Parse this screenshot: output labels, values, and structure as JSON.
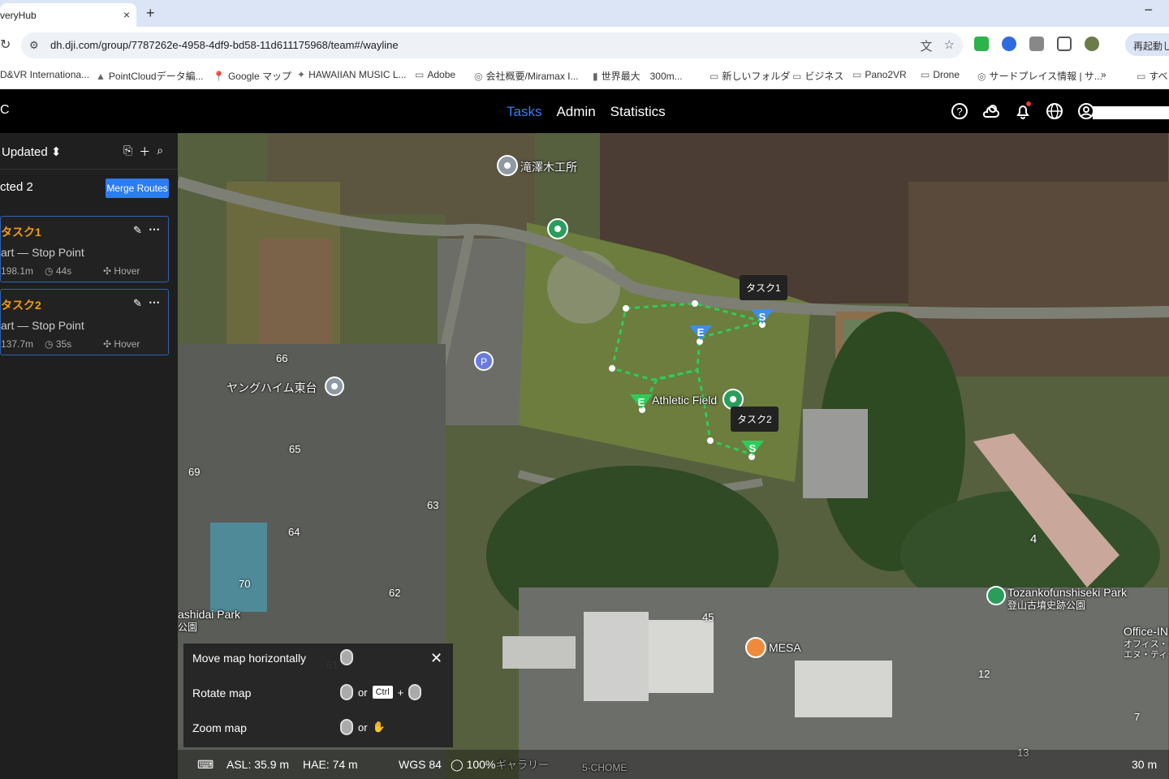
{
  "browser": {
    "tab_title": "veryHub",
    "tab_close": "×",
    "new_tab": "+",
    "url": "dh.dji.com/group/7787262e-4958-4df9-bd58-11d611175968/team#/wayline",
    "restart_label": "再起動し",
    "bookmarks": [
      {
        "label": "D&VR Internationa...",
        "icon": ""
      },
      {
        "label": "PointCloudデータ編...",
        "icon": "▲"
      },
      {
        "label": "Google マップ",
        "icon": "📍"
      },
      {
        "label": "HAWAIIAN MUSIC L...",
        "icon": "✦"
      },
      {
        "label": "Adobe",
        "icon": "▭"
      },
      {
        "label": "会社概要/Miramax I...",
        "icon": "◎"
      },
      {
        "label": "世界最大　300m...",
        "icon": "▮"
      },
      {
        "label": "新しいフォルダ",
        "icon": "▭"
      },
      {
        "label": "ビジネス",
        "icon": "▭"
      },
      {
        "label": "Pano2VR",
        "icon": "▭"
      },
      {
        "label": "Drone",
        "icon": "▭"
      },
      {
        "label": "サードプレイス情報 | サ...",
        "icon": "◎"
      },
      {
        "label": "»",
        "icon": ""
      },
      {
        "label": "すべ",
        "icon": "▭"
      }
    ]
  },
  "header": {
    "logo": "C",
    "tabs": [
      {
        "label": "Tasks",
        "active": true
      },
      {
        "label": "Admin",
        "active": false
      },
      {
        "label": "Statistics",
        "active": false
      }
    ],
    "icons": [
      "help-icon",
      "weather-icon",
      "bell-icon",
      "globe-icon",
      "user-icon"
    ]
  },
  "sidebar": {
    "sort_label": "Updated",
    "sort_arrow": "⬍",
    "selected_label": "cted 2",
    "merge_label": "Merge Routes",
    "tasks": [
      {
        "title": "タスク1",
        "route": "art — Stop Point",
        "distance": "198.1m",
        "time": "44s",
        "action": "Hover"
      },
      {
        "title": "タスク2",
        "route": "art — Stop Point",
        "distance": "137.7m",
        "time": "35s",
        "action": "Hover"
      }
    ]
  },
  "map": {
    "labels": {
      "factory": "滝澤木工所",
      "athletic": "Athletic Field",
      "housing": "ヤングハイム東台",
      "park": "Tozankofunshiseki Park",
      "park_jp": "登山古墳史跡公園",
      "mesa": "MESA",
      "office": "Office-IN",
      "office_jp": "オフィス・イン",
      "office_jp2": "エヌ・ティー・",
      "shidai": "ashidai Park",
      "shidai_jp": "公園",
      "gallery": "ギャラリー",
      "chome": "5-CHOME"
    },
    "numbers": [
      "66",
      "65",
      "69",
      "63",
      "64",
      "70",
      "62",
      "45",
      "4",
      "12",
      "7",
      "13",
      "61"
    ],
    "route_tags": [
      "タスク1",
      "タスク2"
    ],
    "markers": {
      "start": "S",
      "end": "E",
      "parking": "P"
    },
    "route_color": "#2ecc5a"
  },
  "help": {
    "move": "Move map horizontally",
    "rotate": "Rotate map",
    "zoom": "Zoom map",
    "or": "or",
    "ctrl": "Ctrl",
    "plus": "+",
    "close": "✕"
  },
  "status": {
    "asl": "ASL: 35.9 m",
    "hae": "HAE: 74 m",
    "datum": "WGS 84",
    "zoom": "100%",
    "scale": "30 m"
  }
}
